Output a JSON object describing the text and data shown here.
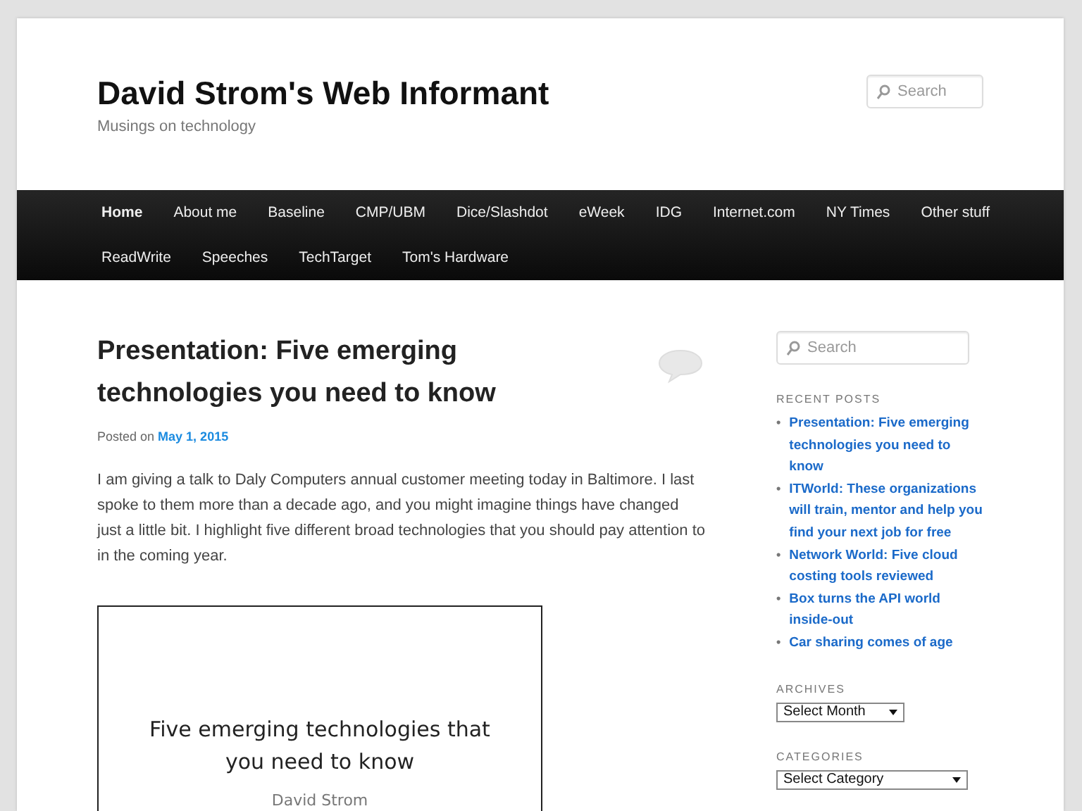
{
  "site": {
    "title": "David Strom's Web Informant",
    "tagline": "Musings on technology"
  },
  "header_search": {
    "placeholder": "Search"
  },
  "nav": [
    {
      "label": "Home",
      "selected": true
    },
    {
      "label": "About me",
      "selected": false
    },
    {
      "label": "Baseline",
      "selected": false
    },
    {
      "label": "CMP/UBM",
      "selected": false
    },
    {
      "label": "Dice/Slashdot",
      "selected": false
    },
    {
      "label": "eWeek",
      "selected": false
    },
    {
      "label": "IDG",
      "selected": false
    },
    {
      "label": "Internet.com",
      "selected": false
    },
    {
      "label": "NY Times",
      "selected": false
    },
    {
      "label": "Other stuff",
      "selected": false
    },
    {
      "label": "ReadWrite",
      "selected": false
    },
    {
      "label": "Speeches",
      "selected": false
    },
    {
      "label": "TechTarget",
      "selected": false
    },
    {
      "label": "Tom's Hardware",
      "selected": false
    }
  ],
  "post": {
    "title": "Presentation: Five emerging technologies you need to know",
    "posted_on": "Posted on",
    "date": "May 1, 2015",
    "body": "I am giving a talk to Daly Computers annual customer meeting today in Baltimore. I last spoke to them more than a decade ago, and you might imagine things have changed just a little bit. I highlight five different broad technologies that you should pay attention to in the coming year.",
    "slide": {
      "title": "Five emerging technologies that you need to know",
      "author": "David Strom"
    }
  },
  "sidebar": {
    "search": {
      "placeholder": "Search"
    },
    "recent_posts": {
      "heading": "RECENT POSTS",
      "bullet": "•",
      "items": [
        "Presentation: Five emerging technologies you need to know",
        "ITWorld: These organizations will train, mentor and help you find your next job for free",
        "Network World: Five cloud costing tools reviewed",
        "Box turns the API world inside-out",
        "Car sharing comes of age"
      ]
    },
    "archives": {
      "heading": "ARCHIVES",
      "select": "Select Month"
    },
    "categories": {
      "heading": "CATEGORIES",
      "select": "Select Category"
    }
  }
}
